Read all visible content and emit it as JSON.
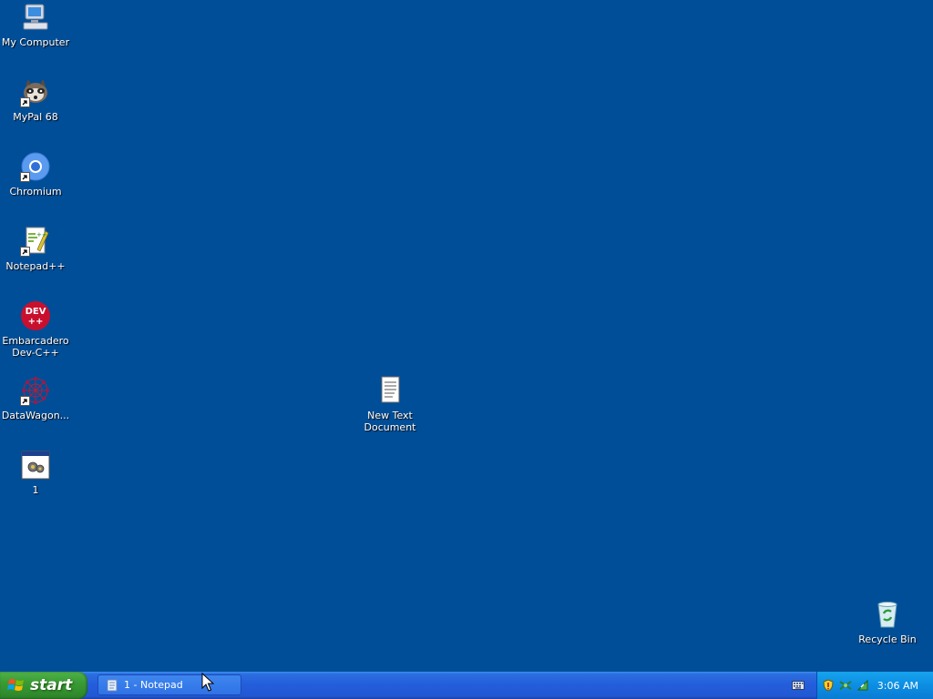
{
  "desktop": {
    "icons": [
      {
        "label": "My Computer"
      },
      {
        "label": "MyPal 68"
      },
      {
        "label": "Chromium"
      },
      {
        "label": "Notepad++"
      },
      {
        "label": "Embarcadero\nDev-C++"
      },
      {
        "label": "DataWagon..."
      },
      {
        "label": "1"
      },
      {
        "label": "New Text\nDocument"
      },
      {
        "label": "Recycle Bin"
      }
    ],
    "background_color": "#004e98"
  },
  "taskbar": {
    "start_label": "start",
    "tasks": [
      {
        "label": "1 - Notepad"
      }
    ],
    "tray": {
      "clock": "3:06 AM"
    }
  }
}
